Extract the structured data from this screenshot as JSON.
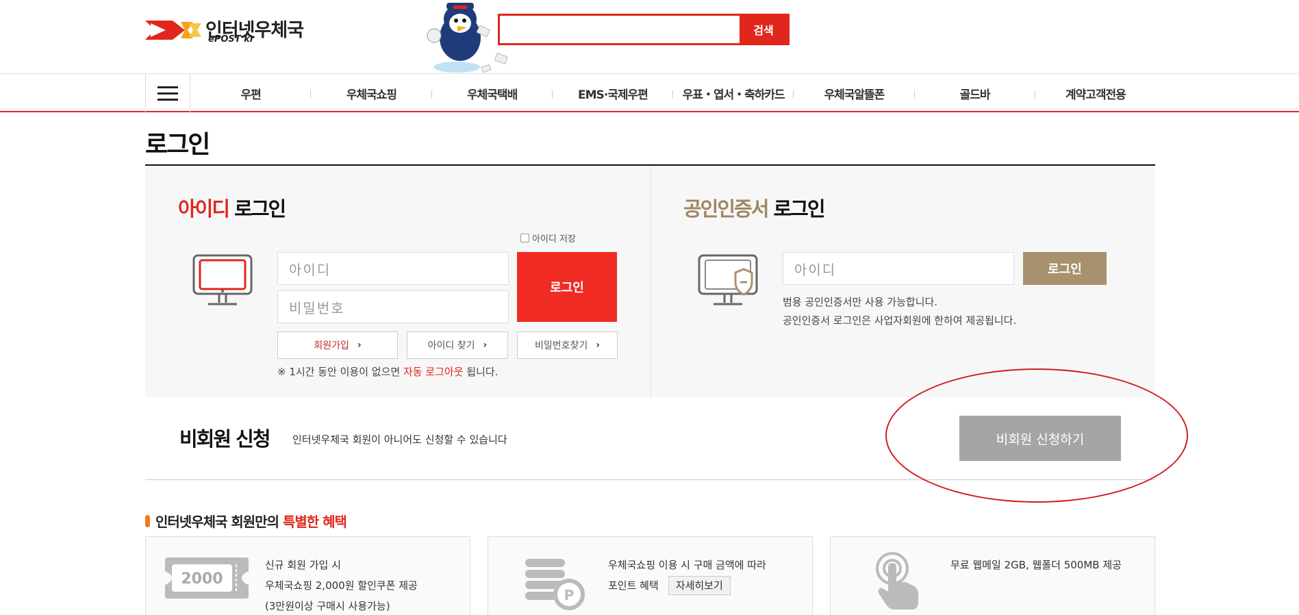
{
  "header": {
    "logo_text": "인터넷우체국",
    "logo_sub": "ePOST kr",
    "search_placeholder": "",
    "search_button": "검색"
  },
  "nav": {
    "items": [
      "우편",
      "우체국쇼핑",
      "우체국택배",
      "EMS·국제우편",
      "우표・엽서・축하카드",
      "우체국알뜰폰",
      "골드바",
      "계약고객전용"
    ]
  },
  "page": {
    "title": "로그인"
  },
  "id_login": {
    "title_accent": "아이디",
    "title_rest": " 로그인",
    "save_id_label": "아이디 저장",
    "id_placeholder": "아이디",
    "pw_placeholder": "비밀번호",
    "login_button": "로그인",
    "signup_button": "회원가입",
    "find_id_button": "아이디 찾기",
    "find_pw_button": "비밀번호찾기",
    "notice_prefix": "※ 1시간 동안 이용이 없으면 ",
    "notice_accent": "자동 로그아웃",
    "notice_suffix": " 됩니다."
  },
  "cert_login": {
    "title_accent": "공인인증서",
    "title_rest": " 로그인",
    "id_placeholder": "아이디",
    "login_button": "로그인",
    "desc_line1": "범용 공인인증서만 사용 가능합니다.",
    "desc_line2": "공인인증서 로그인은 사업자회원에 한하여 제공됩니다."
  },
  "nonmember": {
    "title": "비회원 신청",
    "desc": "인터넷우체국 회원이 아니어도 신청할 수 있습니다",
    "button": "비회원 신청하기"
  },
  "benefits": {
    "title_prefix": "인터넷우체국 회원만의 ",
    "title_accent": "특별한 혜택",
    "cards": [
      {
        "icon_label": "2000",
        "line1": "신규 회원 가입 시",
        "line2": "우체국쇼핑 2,000원 할인쿠폰 제공",
        "line3": "(3만원이상 구매시 사용가능)"
      },
      {
        "line1": "우체국쇼핑 이용 시 구매 금액에 따라",
        "line2": "포인트 혜택",
        "button": "자세히보기"
      },
      {
        "line1": "무료 웹메일 2GB, 웹폴더 500MB 제공"
      }
    ]
  },
  "colors": {
    "accent_red": "#e1261c",
    "cert_brown": "#a8916d",
    "nonmember_gray": "#a5a5a5"
  }
}
